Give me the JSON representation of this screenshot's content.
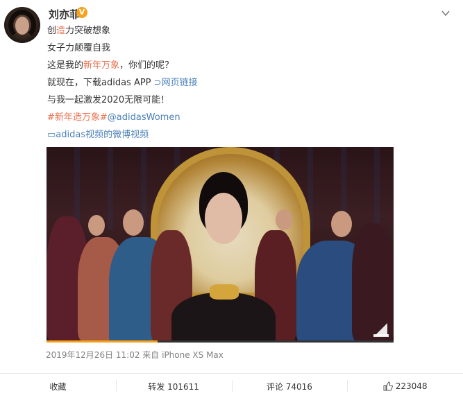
{
  "post": {
    "username": "刘亦菲",
    "verified_badge": "V",
    "lines": [
      {
        "a": "创",
        "b": "造",
        "c": "力突破想象"
      },
      {
        "text": "女子力颠覆自我"
      },
      {
        "a": "这是我的",
        "b": "新年万象",
        "c": "，你们的呢？"
      },
      {
        "a": "就现在，下载adidas APP ",
        "link_icon": "⊃",
        "link": "网页链接"
      },
      {
        "text": "与我一起激发2020无限可能！"
      },
      {
        "topic": "#新年造万象#",
        "mention": "@adidasWomen"
      },
      {
        "video_icon": "▭",
        "video_link": "adidas视频的微博视频"
      }
    ],
    "progress": 0.32,
    "meta": "2019年12月26日 11:02  来自 iPhone XS Max"
  },
  "actions": {
    "favorite": "收藏",
    "repost": "转发 101611",
    "comment": "评论 74016",
    "like": "223048"
  },
  "colors": {
    "accent": "#eb7350",
    "link_blue": "#4a7fb8",
    "progress": "#f7a21b"
  }
}
